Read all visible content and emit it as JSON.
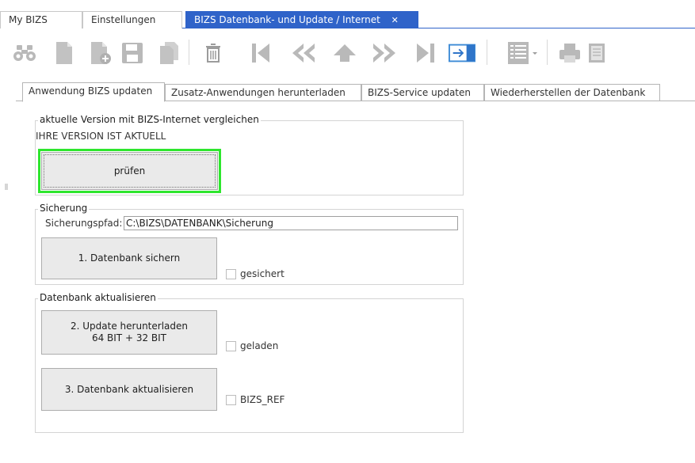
{
  "doc_tabs": [
    {
      "label": "My BIZS"
    },
    {
      "label": "Einstellungen"
    },
    {
      "label": "BIZS Datenbank- und Update / Internet",
      "close": "✕"
    }
  ],
  "inner_tabs": [
    {
      "label": "Anwendung BIZS updaten"
    },
    {
      "label": "Zusatz-Anwendungen herunterladen"
    },
    {
      "label": "BIZS-Service updaten"
    },
    {
      "label": "Wiederherstellen der Datenbank"
    }
  ],
  "version_group": {
    "title": "aktuelle Version mit BIZS-Internet vergleichen",
    "status": "IHRE VERSION IST AKTUELL",
    "check_button": "prüfen"
  },
  "backup_group": {
    "title": "Sicherung",
    "path_label": "Sicherungspfad:",
    "path_value": "C:\\BIZS\\DATENBANK\\Sicherung",
    "backup_button": "1. Datenbank sichern",
    "backed_up_label": "gesichert"
  },
  "update_group": {
    "title": "Datenbank aktualisieren",
    "download_button": "2. Update herunterladen\n64 BIT + 32 BIT",
    "downloaded_label": "geladen",
    "update_button": "3. Datenbank aktualisieren",
    "ref_label": "BIZS_REF"
  },
  "colors": {
    "accent": "#2f63c9",
    "focus_ring": "#2ee62e",
    "icon_gray": "#b9b9b9"
  },
  "toolbar_icons": [
    "binoculars-icon",
    "new-document-icon",
    "add-document-icon",
    "save-icon",
    "copy-icon",
    "delete-icon",
    "first-record-icon",
    "previous-page-icon",
    "up-icon",
    "next-page-icon",
    "last-record-icon",
    "exit-icon",
    "list-view-icon",
    "print-icon",
    "report-icon"
  ]
}
